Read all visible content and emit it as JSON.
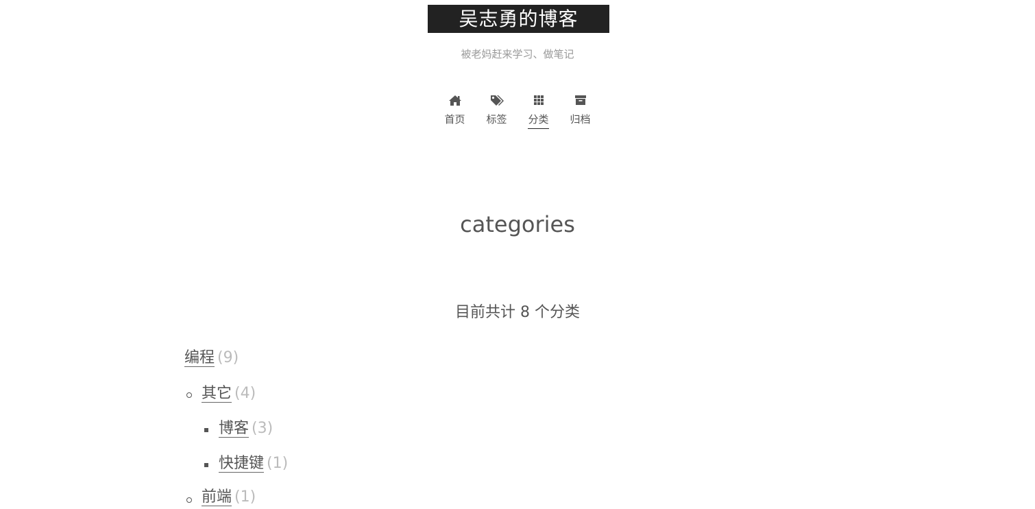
{
  "site": {
    "title": "吴志勇的博客",
    "subtitle": "被老妈赶来学习、做笔记"
  },
  "nav": {
    "items": [
      {
        "label": "首页",
        "icon": "home-icon"
      },
      {
        "label": "标签",
        "icon": "tags-icon"
      },
      {
        "label": "分类",
        "icon": "th-icon",
        "active": true
      },
      {
        "label": "归档",
        "icon": "archive-icon"
      }
    ]
  },
  "page": {
    "title": "categories",
    "count_text": "目前共计 8 个分类"
  },
  "categories": [
    {
      "name": "编程",
      "count": "(9)",
      "level": 0
    },
    {
      "name": "其它",
      "count": "(4)",
      "level": 1
    },
    {
      "name": "博客",
      "count": "(3)",
      "level": 2
    },
    {
      "name": "快捷键",
      "count": "(1)",
      "level": 2
    },
    {
      "name": "前端",
      "count": "(1)",
      "level": 1
    }
  ],
  "colors": {
    "brand_bg": "#222222",
    "text": "#555555",
    "muted": "#999999",
    "count": "#bbbbbb"
  }
}
